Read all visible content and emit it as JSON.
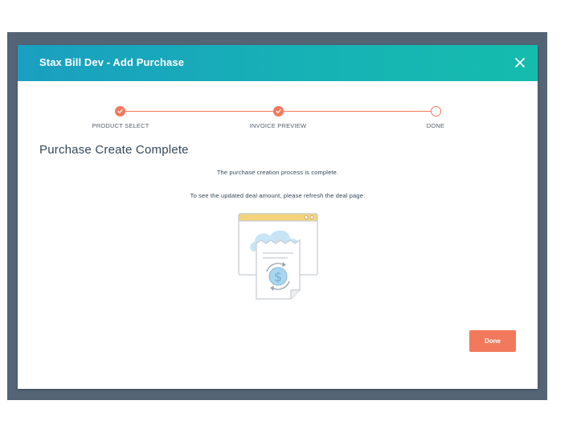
{
  "modal": {
    "title": "Stax Bill Dev - Add Purchase",
    "close_icon": "close-icon"
  },
  "stepper": {
    "steps": [
      {
        "label": "PRODUCT SELECT",
        "status": "complete"
      },
      {
        "label": "INVOICE PREVIEW",
        "status": "complete"
      },
      {
        "label": "DONE",
        "status": "current"
      }
    ],
    "accent_color": "#f2795b"
  },
  "content": {
    "heading": "Purchase Create Complete",
    "message_1": "The purchase creation process is complete.",
    "message_2": "To see the updated deal amount, please refresh the deal page.",
    "illustration_icon": "invoice-receipt-dollar-icon"
  },
  "footer": {
    "done_label": "Done"
  },
  "colors": {
    "header_gradient_start": "#1a9fc0",
    "header_gradient_end": "#15bcad",
    "overlay": "#546475",
    "primary_button": "#f2795b"
  }
}
